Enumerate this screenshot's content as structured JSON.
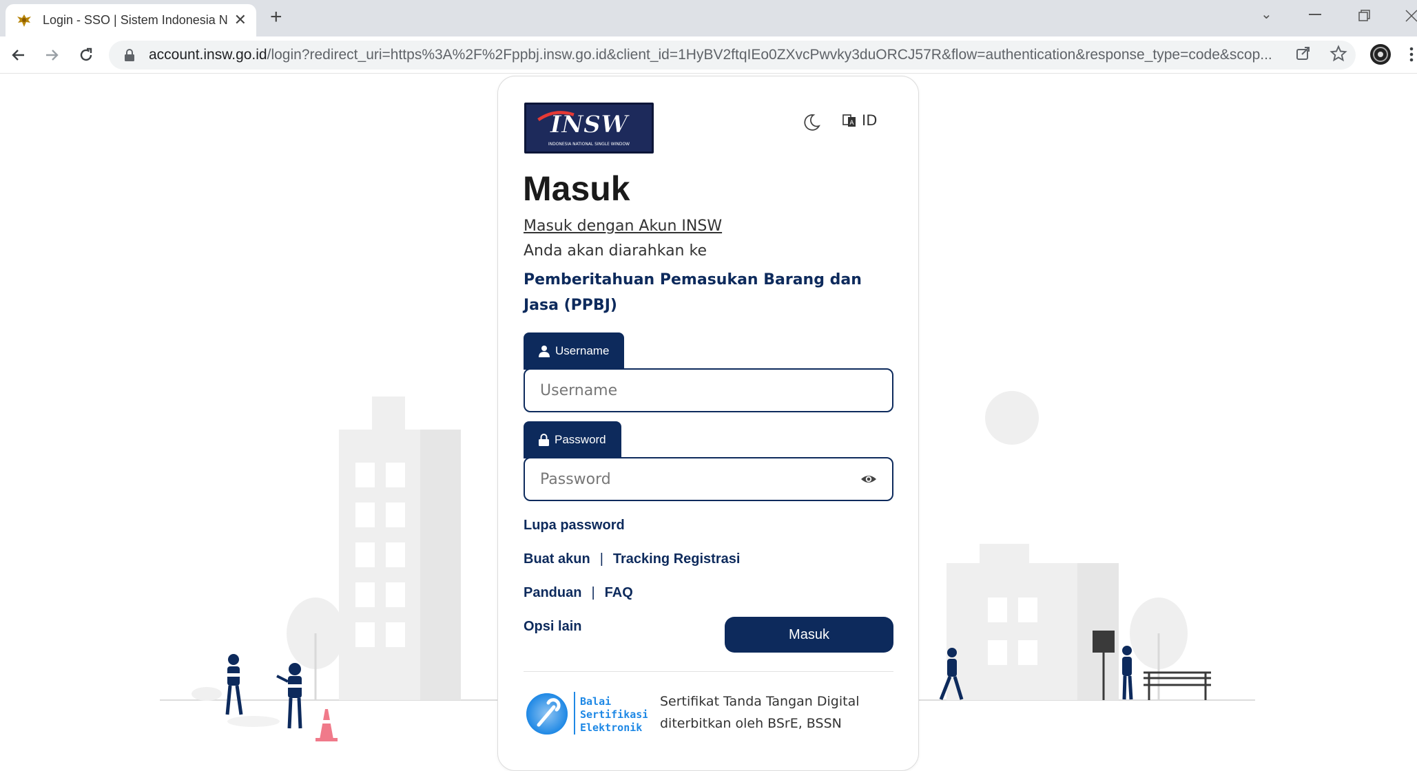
{
  "browser": {
    "tab_title": "Login - SSO | Sistem Indonesia N",
    "new_tab": "+",
    "url_host": "account.insw.go.id",
    "url_rest": "/login?redirect_uri=https%3A%2F%2Fppbj.insw.go.id&client_id=1HyBV2ftqIEo0ZXvcPwvky3duORCJ57R&flow=authentication&response_type=code&scop..."
  },
  "login": {
    "logo_text": "INSW",
    "logo_subtext": "INDONESIA NATIONAL SINGLE WINDOW",
    "lang_label": "ID",
    "title": "Masuk",
    "link_insw": "Masuk dengan Akun INSW",
    "redirect_text": "Anda akan diarahkan ke",
    "app_name": "Pemberitahuan Pemasukan Barang dan Jasa (PPBJ)",
    "username_label": "Username",
    "username_placeholder": "Username",
    "password_label": "Password",
    "password_placeholder": "Password",
    "forgot_password": "Lupa password",
    "create_account": "Buat akun",
    "tracking": "Tracking Registrasi",
    "guide": "Panduan",
    "faq": "FAQ",
    "other_options": "Opsi lain",
    "separator": "|",
    "submit": "Masuk",
    "bsre_logo_line1": "Balai",
    "bsre_logo_line2": "Sertifikasi",
    "bsre_logo_line3": "Elektronik",
    "cert_line1": "Sertifikat Tanda Tangan Digital",
    "cert_line2": "diterbitkan oleh BSrE, BSSN"
  },
  "colors": {
    "primary": "#0d2a5c",
    "scene_gray": "#f0f0f0"
  }
}
